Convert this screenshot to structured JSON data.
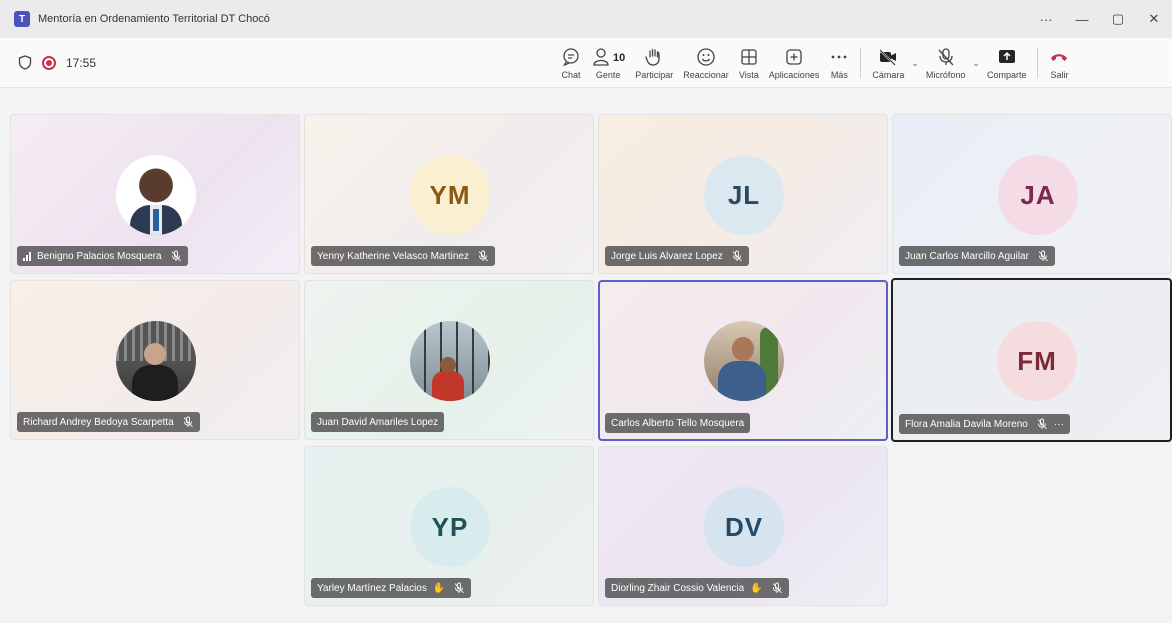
{
  "window": {
    "title": "Mentoría en Ordenamiento Territorial DT Chocó",
    "controls": [
      "···",
      "—",
      "▢",
      "✕"
    ]
  },
  "toolbar": {
    "timer": "17:55",
    "people_count": "10",
    "items": [
      {
        "key": "chat",
        "label": "Chat",
        "icon": "chat-icon"
      },
      {
        "key": "people",
        "label": "Gente",
        "icon": "people-icon"
      },
      {
        "key": "raise",
        "label": "Participar",
        "icon": "raise-hand-icon"
      },
      {
        "key": "react",
        "label": "Reaccionar",
        "icon": "smile-icon"
      },
      {
        "key": "view",
        "label": "Vista",
        "icon": "grid-icon"
      },
      {
        "key": "apps",
        "label": "Aplicaciones",
        "icon": "plus-square-icon"
      },
      {
        "key": "more",
        "label": "Más",
        "icon": "ellipsis-icon"
      },
      {
        "key": "camera",
        "label": "Cámara",
        "icon": "camera-off-icon"
      },
      {
        "key": "mic",
        "label": "Micrófono",
        "icon": "mic-off-icon"
      },
      {
        "key": "share",
        "label": "Comparte",
        "icon": "share-icon"
      },
      {
        "key": "leave",
        "label": "Salir",
        "icon": "hangup-icon"
      }
    ]
  },
  "participants": [
    {
      "name": "Benigno Palacios Mosquera",
      "type": "photo",
      "muted": true,
      "speaking": true
    },
    {
      "name": "Yenny Katherine Velasco Martinez",
      "initials": "YM",
      "type": "initials",
      "muted": true
    },
    {
      "name": "Jorge Luis Alvarez Lopez",
      "initials": "JL",
      "type": "initials",
      "muted": true
    },
    {
      "name": "Juan Carlos Marcillo Aguilar",
      "initials": "JA",
      "type": "initials",
      "muted": true
    },
    {
      "name": "Richard Andrey Bedoya Scarpetta",
      "type": "photo",
      "muted": true
    },
    {
      "name": "Juan David Amariles Lopez",
      "type": "photo",
      "muted": false
    },
    {
      "name": "Carlos Alberto Tello Mosquera",
      "type": "photo",
      "muted": false,
      "active": true
    },
    {
      "name": "Flora Amalia Davila Moreno",
      "initials": "FM",
      "type": "initials",
      "muted": true,
      "pinned": true
    },
    {
      "name": "Yarley Martínez Palacios",
      "initials": "YP",
      "type": "initials",
      "muted": true,
      "hand": true
    },
    {
      "name": "Diorling Zhair Cossio Valencia",
      "initials": "DV",
      "type": "initials",
      "muted": true,
      "hand": true
    }
  ],
  "colors": {
    "accent": "#5b5fc7",
    "record": "#c4314b",
    "leave": "#c4314b",
    "ym_bg": "#fbefd2",
    "ym_fg": "#8a5a12",
    "jl_bg": "#dbe8ef",
    "jl_fg": "#2b4a5e",
    "ja_bg": "#f5dbe6",
    "ja_fg": "#7a2a4d",
    "fm_bg": "#f5dcdf",
    "fm_fg": "#7a2a38",
    "yp_bg": "#d8ecee",
    "yp_fg": "#215258",
    "dv_bg": "#d6e4ef",
    "dv_fg": "#244866"
  }
}
